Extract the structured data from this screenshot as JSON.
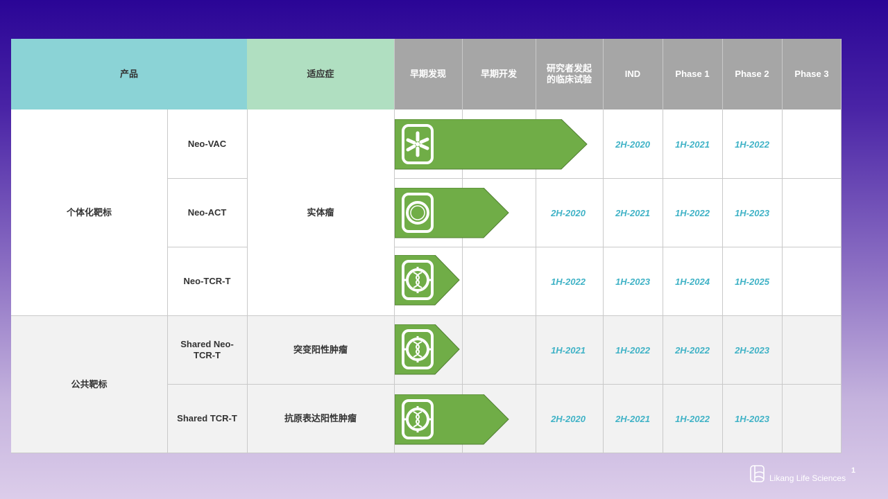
{
  "headers": {
    "product": "产品",
    "indication": "适应症",
    "stages": [
      "早期发现",
      "早期开发",
      "研究者发起\n的临床试验",
      "IND",
      "Phase 1",
      "Phase 2",
      "Phase 3"
    ]
  },
  "groups": [
    {
      "label": "个体化靶标",
      "indication": "实体瘤"
    },
    {
      "label": "公共靶标"
    }
  ],
  "rows": [
    {
      "product": "Neo-VAC",
      "indication": "",
      "progress_stage_count": 3,
      "icon": "cell-virus-icon",
      "dates": [
        "",
        "",
        "",
        "2H-2020",
        "1H-2021",
        "1H-2022",
        ""
      ]
    },
    {
      "product": "Neo-ACT",
      "indication": "",
      "progress_stage_count": 2,
      "icon": "circle-cell-icon",
      "dates": [
        "",
        "",
        "2H-2020",
        "2H-2021",
        "1H-2022",
        "1H-2023",
        ""
      ]
    },
    {
      "product": "Neo-TCR-T",
      "indication": "",
      "progress_stage_count": 1,
      "icon": "dna-cell-icon",
      "dates": [
        "",
        "",
        "1H-2022",
        "1H-2023",
        "1H-2024",
        "1H-2025",
        ""
      ]
    },
    {
      "product": "Shared Neo-TCR-T",
      "indication": "突变阳性肿瘤",
      "progress_stage_count": 1,
      "icon": "dna-cell-icon",
      "dates": [
        "",
        "",
        "1H-2021",
        "1H-2022",
        "2H-2022",
        "2H-2023",
        ""
      ]
    },
    {
      "product": "Shared TCR-T",
      "indication": "抗原表达阳性肿瘤",
      "progress_stage_count": 2,
      "icon": "dna-cell-icon",
      "dates": [
        "",
        "",
        "2H-2020",
        "2H-2021",
        "1H-2022",
        "1H-2023",
        ""
      ]
    }
  ],
  "footer": {
    "company": "Likang Life Sciences",
    "page_number": "1"
  },
  "colors": {
    "arrow": "#70ad47",
    "date_text": "#3fb2c6",
    "header_product": "#8bd3d6",
    "header_indication": "#b0dfc1",
    "header_stage": "#a6a6a6"
  }
}
